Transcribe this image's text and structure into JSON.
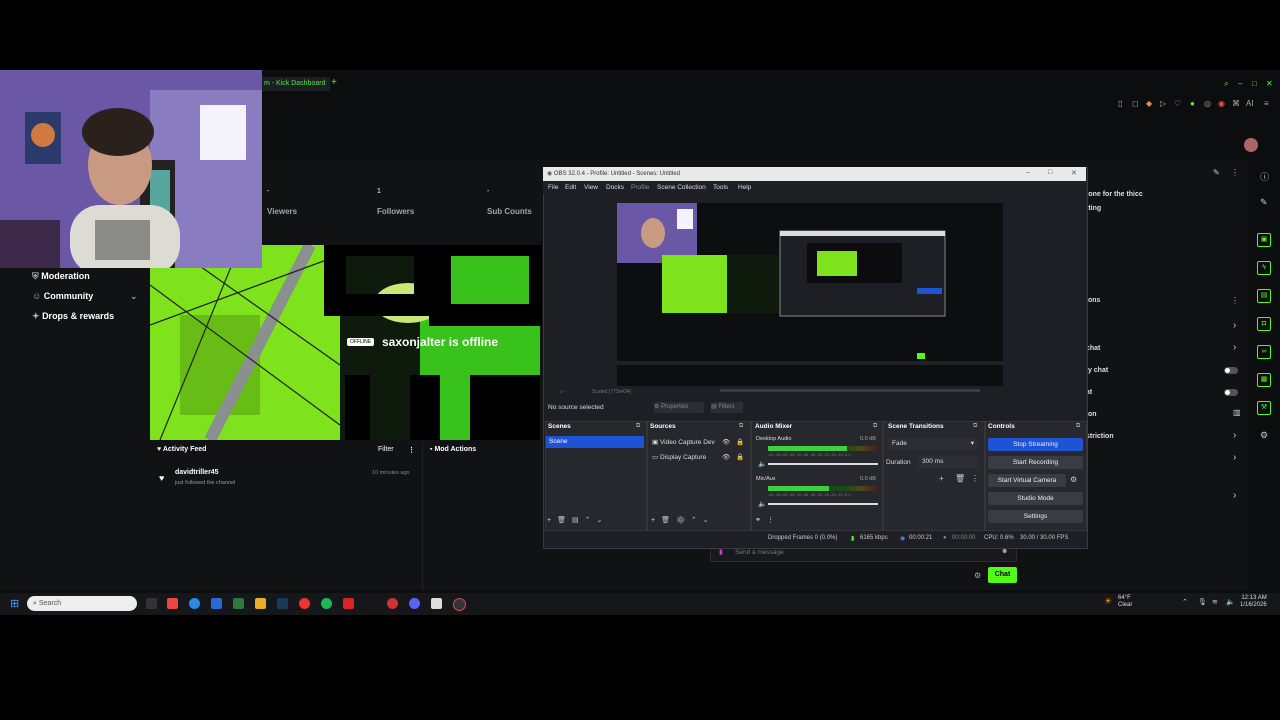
{
  "browser": {
    "tab_title": "m - Kick Dashboard",
    "new_tab": "+"
  },
  "dashboard": {
    "stats": [
      {
        "value": "-",
        "label": "Viewers"
      },
      {
        "value": "1",
        "label": "Followers"
      },
      {
        "value": "-",
        "label": "Sub Counts"
      }
    ],
    "nav": [
      "Moderation",
      "Community",
      "Drops & rewards"
    ],
    "offline_badge": "OFFLINE",
    "offline_text": "saxonjalter is offline",
    "activity_feed": {
      "title": "Activity Feed",
      "filter": "Filter",
      "items": [
        {
          "user": "davidtriller45",
          "text": "just followed the channel",
          "time": "10 minutes ago"
        }
      ]
    },
    "mod_actions": "Mod Actions",
    "right_texts": [
      "tone for the thicc",
      "tting",
      "ions",
      "chat",
      "ly chat",
      "at",
      "ion",
      "striction"
    ],
    "chat_placeholder": "Send a message",
    "chat_button": "Chat"
  },
  "obs": {
    "title": "OBS 32.0.4 - Profile: Untitled - Scenes: Untitled",
    "menu": [
      "File",
      "Edit",
      "View",
      "Docks",
      "Profile",
      "Scene Collection",
      "Tools",
      "Help"
    ],
    "no_source": "No source selected",
    "properties": "Properties",
    "filters": "Filters",
    "scale_info": "Scaled (773x434)",
    "docks": {
      "scenes": {
        "title": "Scenes",
        "items": [
          "Scene"
        ]
      },
      "sources": {
        "title": "Sources",
        "items": [
          "Video Capture Dev",
          "Display Capture"
        ]
      },
      "audio_mixer": {
        "title": "Audio Mixer",
        "channels": [
          {
            "name": "Desktop Audio",
            "db": "0.0 dB",
            "level": 0.72
          },
          {
            "name": "Mic/Aux",
            "db": "0.0 dB",
            "level": 0.55
          }
        ]
      },
      "transitions": {
        "title": "Scene Transitions",
        "transition": "Fade",
        "duration_label": "Duration",
        "duration": "300 ms"
      },
      "controls": {
        "title": "Controls",
        "buttons": [
          "Stop Streaming",
          "Start Recording",
          "Start Virtual Camera",
          "Studio Mode",
          "Settings"
        ]
      }
    },
    "status": {
      "dropped": "Dropped Frames 0 (0.0%)",
      "bitrate": "6165 kbps",
      "stream_time": "00:00:21",
      "rec_time": "00:00:00",
      "cpu": "CPU: 0.6%",
      "fps": "30.00 / 30.00 FPS"
    }
  },
  "taskbar": {
    "search_placeholder": "Search",
    "weather_temp": "64°F",
    "weather_desc": "Clear",
    "time": "12:13 AM",
    "date": "1/16/2026"
  },
  "colors": {
    "kick_green": "#53fc18",
    "obs_blue": "#1f53d6"
  }
}
